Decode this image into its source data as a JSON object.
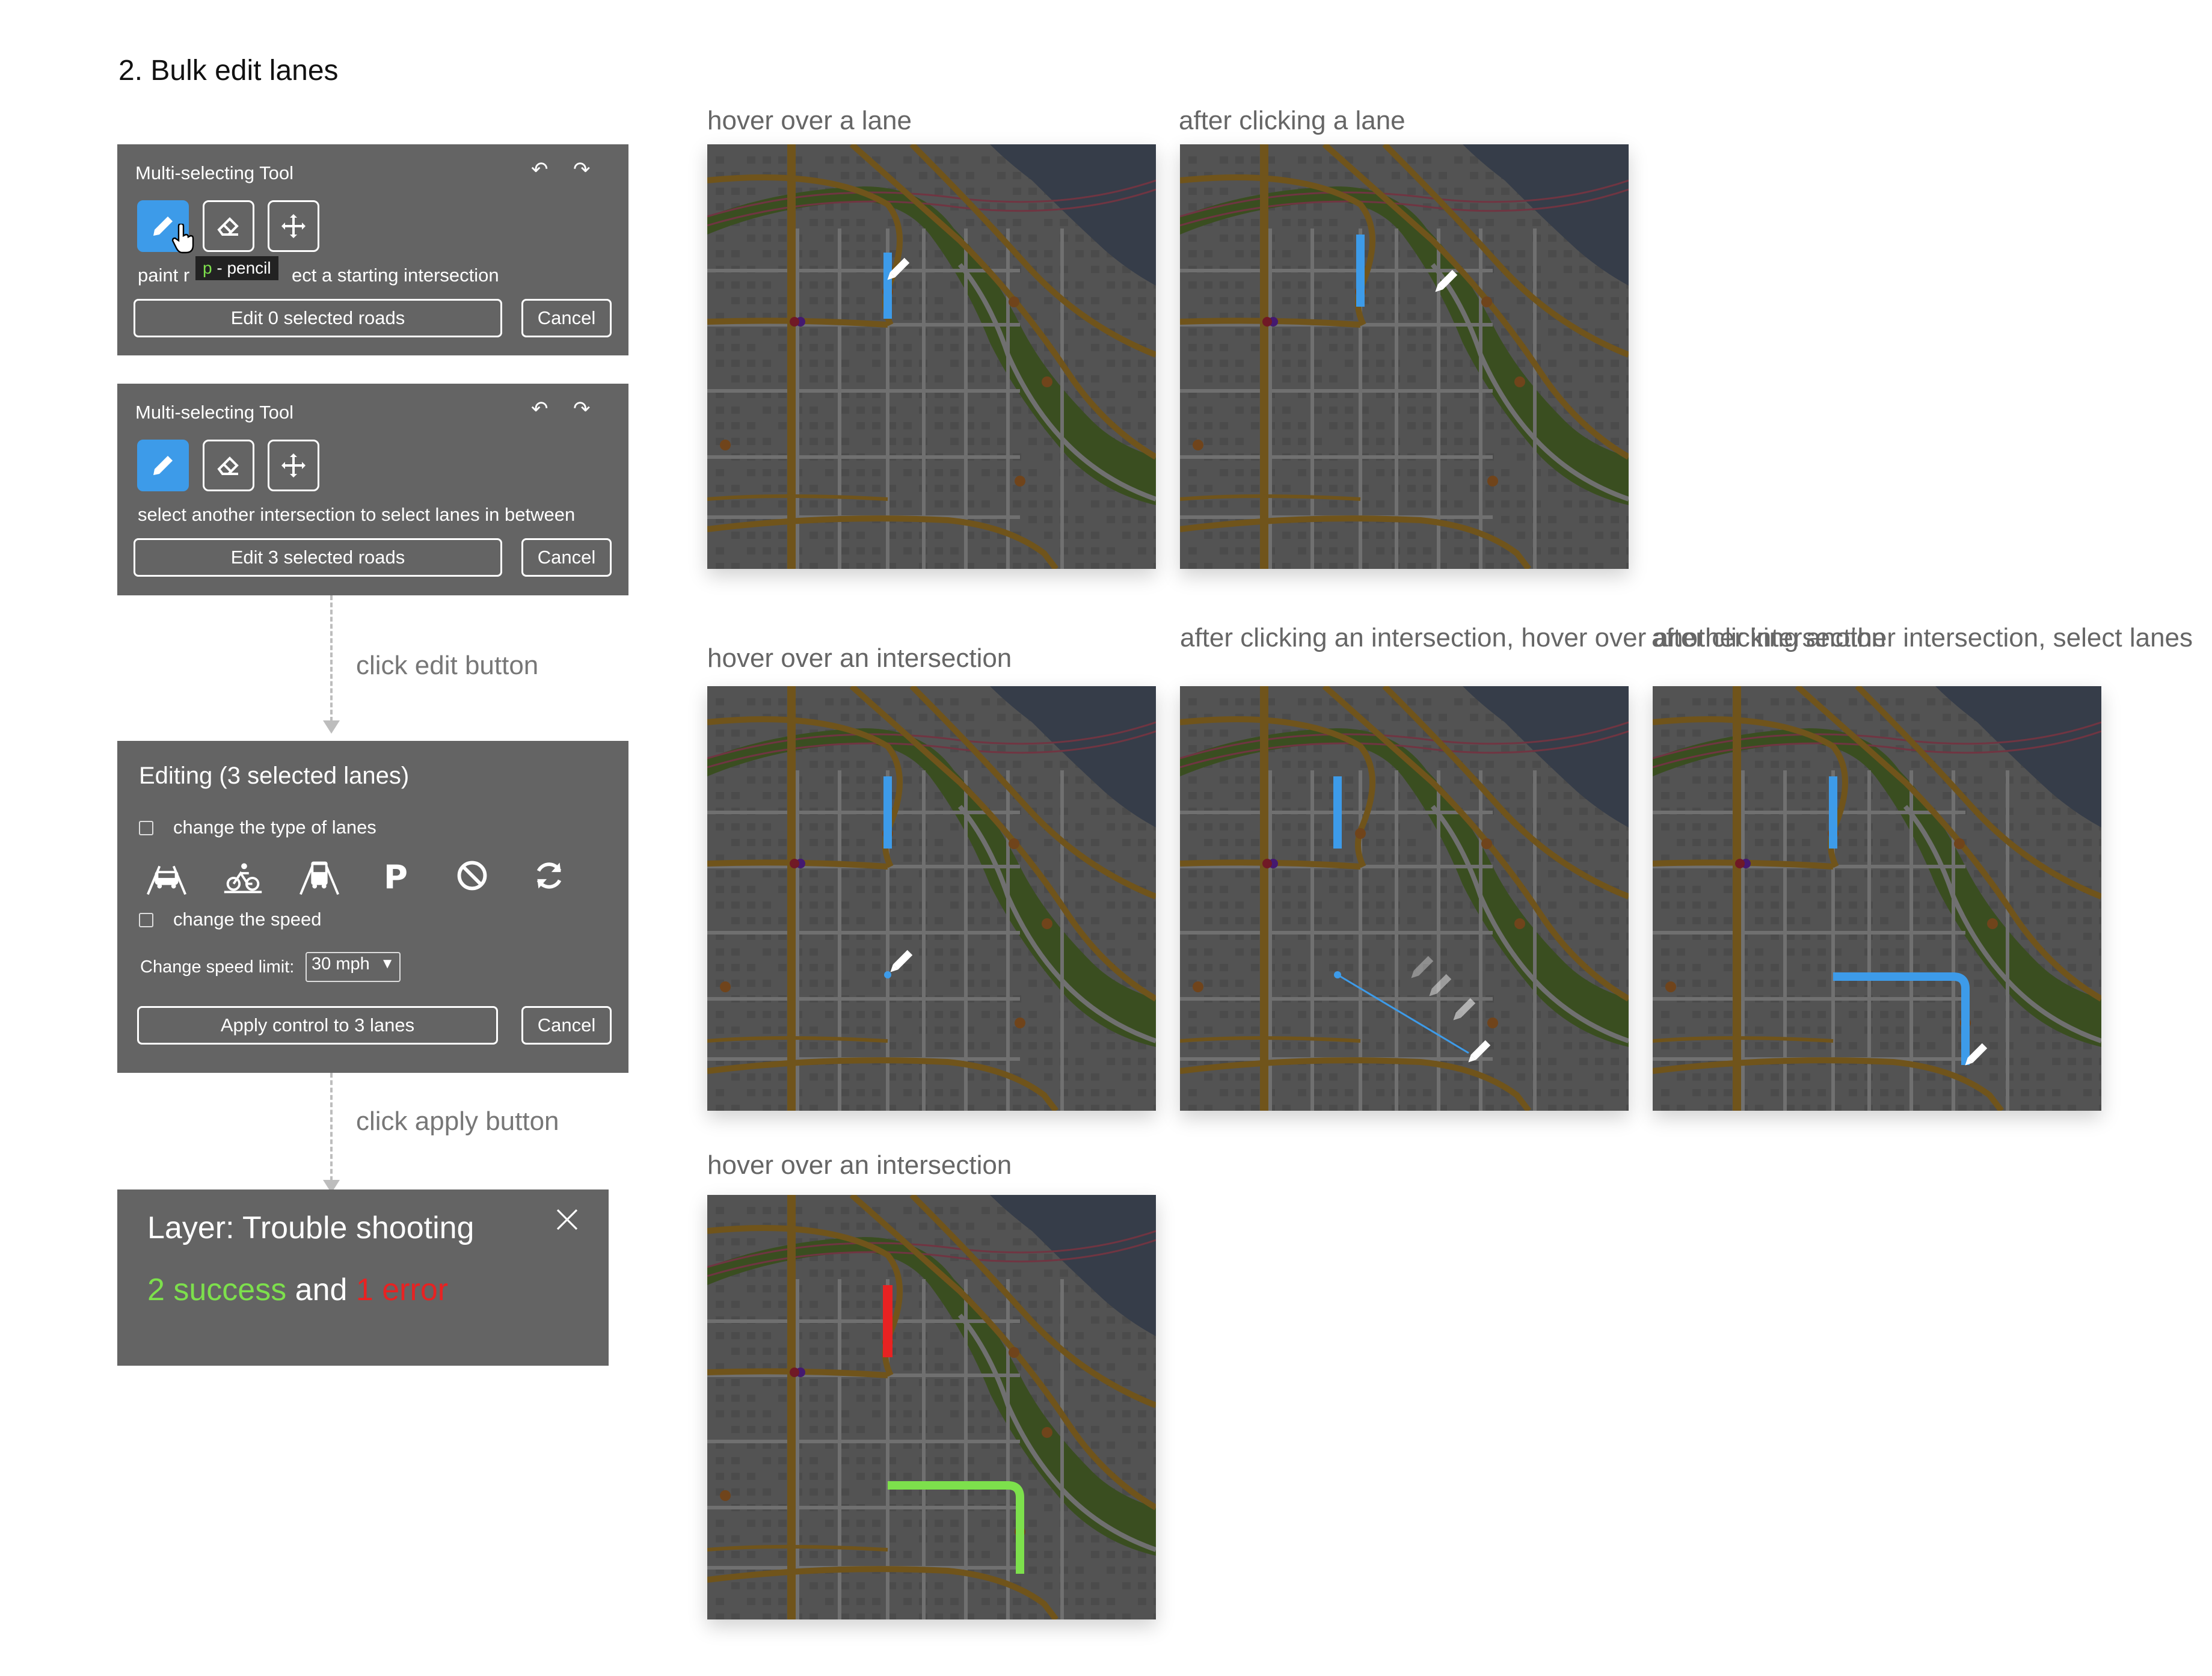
{
  "section_title": "2. Bulk edit lanes",
  "panel1": {
    "title": "Multi-selecting Tool",
    "help_left": "paint r",
    "help_right": "ect a starting intersection",
    "tooltip_key": "p",
    "tooltip_text": "- pencil",
    "edit_button": "Edit 0 selected roads",
    "cancel_button": "Cancel"
  },
  "panel2": {
    "title": "Multi-selecting Tool",
    "help": "select another intersection to select lanes in between",
    "edit_button": "Edit 3 selected roads",
    "cancel_button": "Cancel"
  },
  "flow1_label": "click edit button",
  "panel3": {
    "title": "Editing (3 selected lanes)",
    "type_label": "change the type of lanes",
    "speed_label": "change the speed",
    "speed_limit_label": "Change speed limit:",
    "speed_value": "30 mph",
    "apply_button": "Apply control to 3 lanes",
    "cancel_button": "Cancel",
    "type_icons": [
      "car-lane-icon",
      "bike-lane-icon",
      "bus-lane-icon",
      "parking-icon",
      "no-entry-icon",
      "reverse-icon"
    ]
  },
  "flow2_label": "click apply button",
  "panel4": {
    "title": "Layer: Trouble shooting",
    "success_count": "2",
    "success_word": "success",
    "and_word": "and",
    "error_count": "1",
    "error_word": "error"
  },
  "captions": {
    "map1": "hover over a lane",
    "map2": "after clicking a lane",
    "map3": "hover over an intersection",
    "map4": "after clicking an intersection, hover over another intersection",
    "map5": "after clicking another intersection, select lanes",
    "map6": "hover over an intersection"
  },
  "colors": {
    "accent_blue": "#3d9be9",
    "success_green": "#7de04c",
    "error_red": "#e82222",
    "panel_bg": "#646464",
    "map_bg": "#5b5b5b",
    "arterial": "#7a5c1e",
    "park": "#3f5523",
    "water": "#3b4350"
  }
}
